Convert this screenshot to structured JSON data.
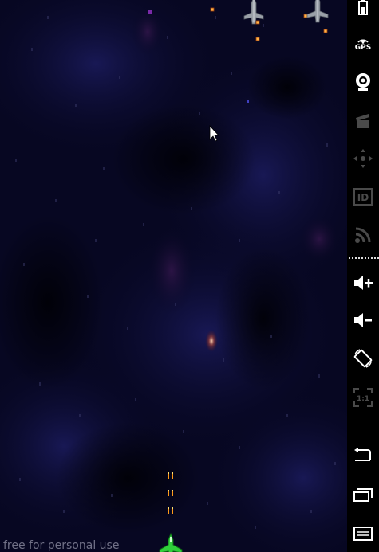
{
  "game": {
    "watermark": "free for personal use",
    "background": "#070722"
  },
  "toolbar": {
    "gps_label": "GPS",
    "buttons": [
      {
        "name": "battery-icon",
        "enabled": true
      },
      {
        "name": "gps-icon",
        "enabled": true
      },
      {
        "name": "camera-icon",
        "enabled": true
      },
      {
        "name": "video-clapper-icon",
        "enabled": false
      },
      {
        "name": "dpad-icon",
        "enabled": false
      },
      {
        "name": "id-icon",
        "enabled": false
      },
      {
        "name": "rss-icon",
        "enabled": false
      },
      {
        "name": "volume-up-icon",
        "enabled": true
      },
      {
        "name": "volume-down-icon",
        "enabled": true
      },
      {
        "name": "rotate-icon",
        "enabled": true
      },
      {
        "name": "scale-1-1-icon",
        "enabled": false
      },
      {
        "name": "back-icon",
        "enabled": true
      },
      {
        "name": "recent-apps-icon",
        "enabled": true
      },
      {
        "name": "menu-icon",
        "enabled": true
      }
    ],
    "scale_label": "1:1",
    "id_label": "ID"
  },
  "colors": {
    "enemy_bullet": "#ffb347",
    "player_bullet": "#ff9a1a",
    "player_ship": "#2fcf3a",
    "enemy_ship": "#9aa0a8",
    "toolbar_icon": "#ffffff",
    "toolbar_icon_disabled": "#4a4a4a"
  }
}
